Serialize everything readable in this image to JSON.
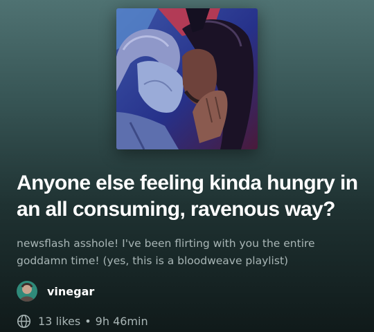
{
  "playlist": {
    "cover": {
      "icon": "playlist-cover-art",
      "colors": {
        "background": "#2a3a8a",
        "accent": "#d8434f",
        "figure_left_hair": "#7b84c2",
        "figure_left_skin": "#8da0cf",
        "figure_right_skin": "#6b3f3a",
        "figure_right_hair": "#1a1222"
      }
    },
    "title": "Anyone else feeling kinda hungry in an all consuming, ravenous way?",
    "description": "newsflash asshole! I've been flirting with you the entire goddamn time! (yes, this is a bloodweave playlist)",
    "owner": {
      "name": "vinegar",
      "avatar_icon": "avatar"
    },
    "visibility_icon": "globe-icon",
    "likes": "13 likes",
    "separator": "•",
    "duration": "9h 46min"
  },
  "colors": {
    "gradient_top": "#4f7272",
    "gradient_bottom": "#101a1a",
    "title": "#ffffff",
    "secondary_text": "#a9b6b6"
  }
}
